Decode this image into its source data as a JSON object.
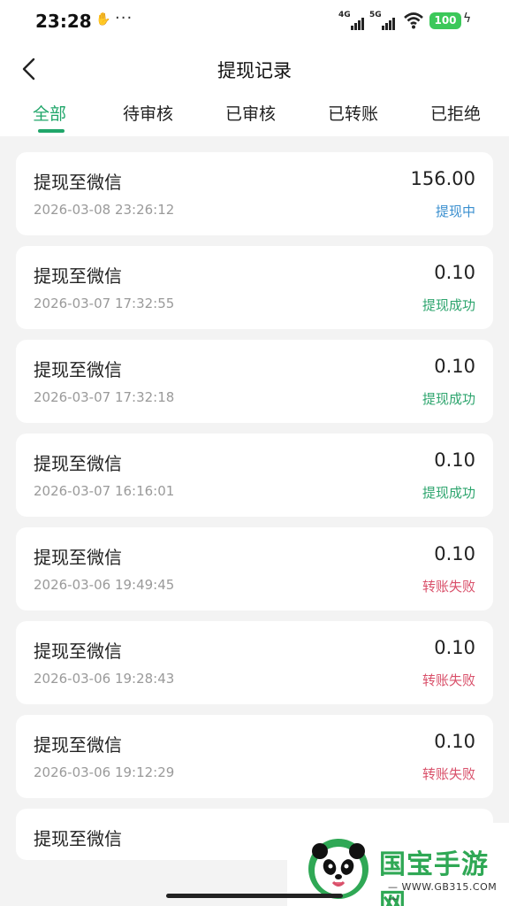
{
  "status_bar": {
    "time": "23:28",
    "app_icon": "hand-icon",
    "more": "···",
    "signal_1": "4G",
    "signal_2": "5G",
    "battery": "100"
  },
  "header": {
    "title": "提现记录",
    "back_icon": "chevron-left-icon"
  },
  "tabs": [
    {
      "label": "全部",
      "active": true
    },
    {
      "label": "待审核",
      "active": false
    },
    {
      "label": "已审核",
      "active": false
    },
    {
      "label": "已转账",
      "active": false
    },
    {
      "label": "已拒绝",
      "active": false
    }
  ],
  "colors": {
    "accent": "#20a66a",
    "processing": "#3a8fcf",
    "success": "#2ea56e",
    "failed": "#d9506a"
  },
  "records": [
    {
      "title": "提现至微信",
      "date": "2026-03-08 23:26:12",
      "amount": "156.00",
      "status": "提现中",
      "status_type": "processing"
    },
    {
      "title": "提现至微信",
      "date": "2026-03-07 17:32:55",
      "amount": "0.10",
      "status": "提现成功",
      "status_type": "success"
    },
    {
      "title": "提现至微信",
      "date": "2026-03-07 17:32:18",
      "amount": "0.10",
      "status": "提现成功",
      "status_type": "success"
    },
    {
      "title": "提现至微信",
      "date": "2026-03-07 16:16:01",
      "amount": "0.10",
      "status": "提现成功",
      "status_type": "success"
    },
    {
      "title": "提现至微信",
      "date": "2026-03-06 19:49:45",
      "amount": "0.10",
      "status": "转账失败",
      "status_type": "failed"
    },
    {
      "title": "提现至微信",
      "date": "2026-03-06 19:28:43",
      "amount": "0.10",
      "status": "转账失败",
      "status_type": "failed"
    },
    {
      "title": "提现至微信",
      "date": "2026-03-06 19:12:29",
      "amount": "0.10",
      "status": "转账失败",
      "status_type": "failed"
    },
    {
      "title": "提现至微信"
    }
  ],
  "watermark": {
    "name": "国宝手游网",
    "url": "— WWW.GB315.COM —"
  }
}
